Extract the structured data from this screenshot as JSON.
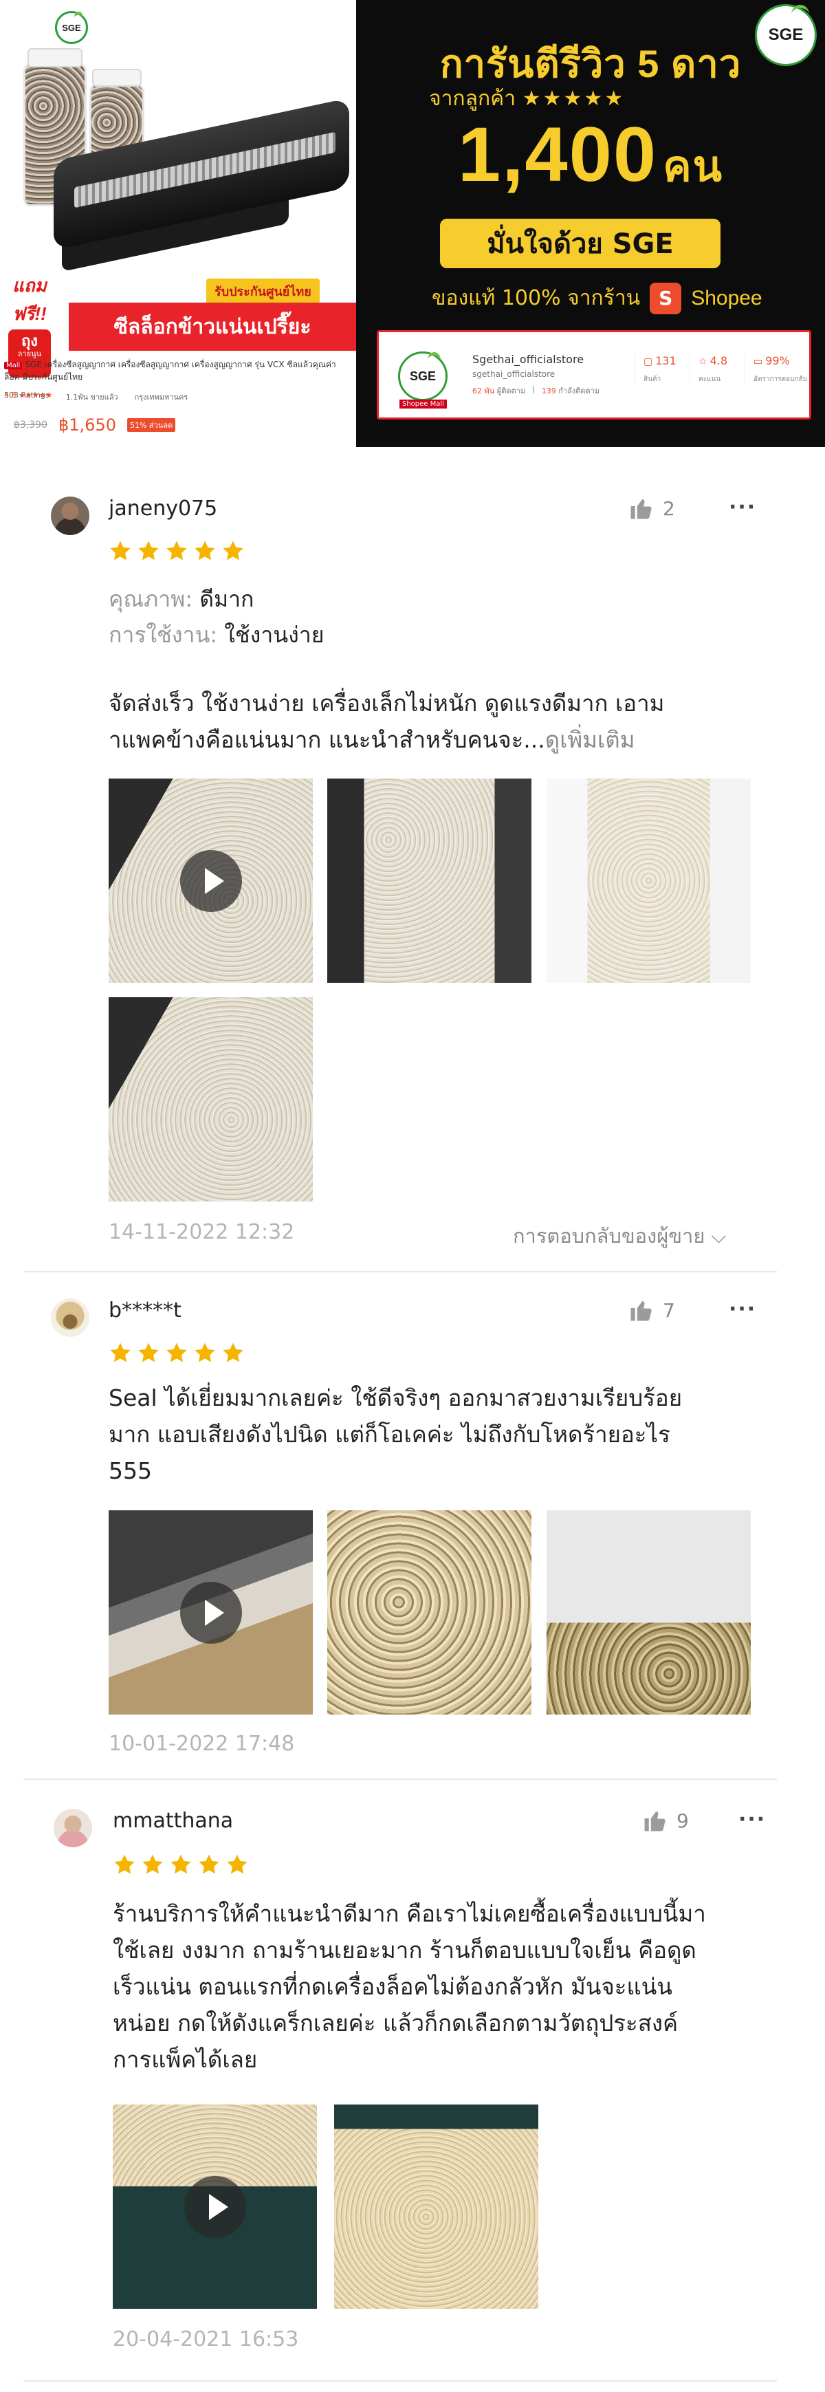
{
  "banner": {
    "product": {
      "logo_text": "SGE",
      "free_gift_top": "แถมฟรี!!",
      "free_gift_bag": "ถุง",
      "free_gift_sub": "ลายนูน",
      "warranty": "รับประกันศูนย์ไทย",
      "tagline": "ซีลล็อกข้าวแน่นเปรี๊ยะ",
      "mall_badge": "Mall",
      "title": "SGE เครื่องซีลสูญญากาศ เครื่องซีลสูญญากาศ เครื่องสูญญากาศ รุ่น VCX ซีลแล้วคุณค่าล็อค มีประกันศูนย์ไทย",
      "rating": "4.8 ★★★★★",
      "ratings_count": "503 Ratings",
      "sold": "1.1พัน ขายแล้ว",
      "location": "กรุงเทพมหานคร",
      "old_price": "฿3,390",
      "price": "฿1,650",
      "discount": "51% ส่วนลด"
    },
    "promo": {
      "logo_text": "SGE",
      "title": "การันตีรีวิว 5 ดาว",
      "from_customers": "จากลูกค้า",
      "from_stars": "★★★★★",
      "big_number": "1,400",
      "big_unit": "คน",
      "confidence": "มั่นใจด้วย SGE",
      "authentic": "ของแท้ 100% จากร้าน",
      "shopee_glyph": "S",
      "shopee": "Shopee"
    },
    "store": {
      "logo_text": "SGE",
      "mall_tag": "Shopee Mall",
      "name": "Sgethai_officialstore",
      "handle": "sgethai_officialstore",
      "followers": "62 พัน",
      "followers_label": "ผู้ติดตาม",
      "following": "139",
      "following_label": "กำลังติดตาม",
      "kpis": [
        {
          "icon": "▢",
          "value": "131",
          "label": "สินค้า"
        },
        {
          "icon": "☆",
          "value": "4.8",
          "label": "คะแนน"
        },
        {
          "icon": "▭",
          "value": "99%",
          "label": "อัตราการตอบกลับ"
        }
      ]
    }
  },
  "reviews": [
    {
      "username": "janeny075",
      "likes": "2",
      "more": "···",
      "rating": 5,
      "quality_label": "คุณภาพ:",
      "quality_value": "ดีมาก",
      "usage_label": "การใช้งาน:",
      "usage_value": "ใช้งานง่าย",
      "text_line1": "จัดส่งเร็ว ใช้งานง่าย เครื่องเล็กไม่หนัก ดูดแรงดีมาก เอาม",
      "text_line2": "าแพคข้างคือแน่นมาก แนะนำสำหรับคนจะ...",
      "see_more": "ดูเพิ่มเติม",
      "date": "14-11-2022 12:32",
      "seller_reply": "การตอบกลับของผู้ขาย ⌵"
    },
    {
      "username": "b*****t",
      "likes": "7",
      "more": "···",
      "rating": 5,
      "text_line1": "Seal ได้เยี่ยมมากเลยค่ะ ใช้ดีจริงๆ ออกมาสวยงามเรียบร้อย",
      "text_line2": "มาก แอบเสียงดังไปนิด แต่ก็โอเคค่ะ ไม่ถึงกับโหดร้ายอะไร",
      "text_line3": "555",
      "date": "10-01-2022 17:48"
    },
    {
      "username": "mmatthana",
      "likes": "9",
      "more": "···",
      "rating": 5,
      "text_line1": "ร้านบริการให้คำแนะนำดีมาก คือเราไม่เคยซื้อเครื่องแบบนี้มา",
      "text_line2": "ใช้เลย งงมาก ถามร้านเยอะมาก ร้านก็ตอบแบบใจเย็น คือดูด",
      "text_line3": "เร็วแน่น ตอนแรกที่กดเครื่องล็อคไม่ต้องกลัวหัก มันจะแน่น",
      "text_line4": "หน่อย กดให้ดังแคร็กเลยค่ะ แล้วก็กดเลือกตามวัตถุประสงค์",
      "text_line5": "การแพ็คได้เลย",
      "date": "20-04-2021 16:53"
    }
  ],
  "colors": {
    "star": "#f5b400",
    "shopee": "#ee4d2d",
    "promo_yellow": "#f7cd2d",
    "muted": "#9a9a9a"
  }
}
